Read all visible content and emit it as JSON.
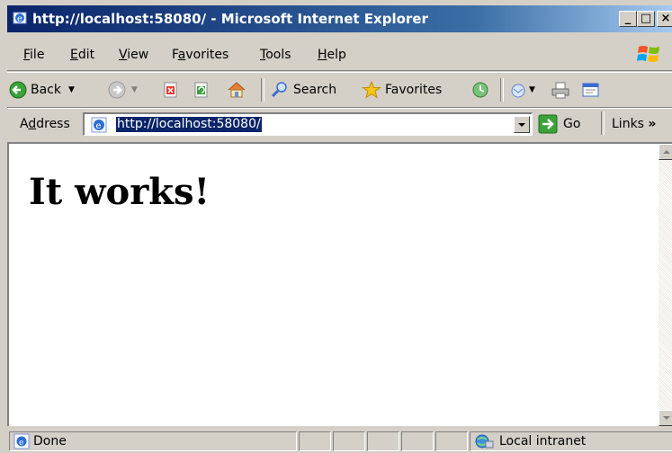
{
  "window": {
    "title": "http://localhost:58080/ - Microsoft Internet Explorer",
    "controls": [
      "_",
      "□",
      "×"
    ]
  },
  "menu": {
    "items": [
      {
        "key": "F",
        "rest": "ile"
      },
      {
        "key": "E",
        "rest": "dit"
      },
      {
        "key": "V",
        "rest": "iew"
      },
      {
        "pre": "F",
        "key": "a",
        "rest": "vorites"
      },
      {
        "key": "T",
        "rest": "ools"
      },
      {
        "key": "H",
        "rest": "elp"
      }
    ]
  },
  "toolbar": {
    "back_label": "Back",
    "search_label": "Search",
    "favorites_label": "Favorites"
  },
  "address": {
    "label_pre": "A",
    "label_key": "d",
    "label_rest": "dress",
    "url": "http://localhost:58080/",
    "go_label": "Go",
    "links_label": "Links",
    "links_more": "»"
  },
  "page": {
    "heading": "It works!"
  },
  "status": {
    "text": "Done",
    "zone": "Local intranet"
  },
  "colors": {
    "titlebar_start": "#0a246a",
    "titlebar_end": "#a6caf0",
    "chrome": "#d4d0c8",
    "selection": "#0a246a"
  },
  "icons": [
    "ie-icon",
    "windows-logo-icon",
    "back-arrow-icon",
    "forward-arrow-icon",
    "stop-icon",
    "refresh-icon",
    "home-icon",
    "search-icon",
    "favorites-star-icon",
    "history-icon",
    "mail-icon",
    "print-icon",
    "edit-icon",
    "go-arrow-icon",
    "page-icon",
    "intranet-zone-icon"
  ]
}
